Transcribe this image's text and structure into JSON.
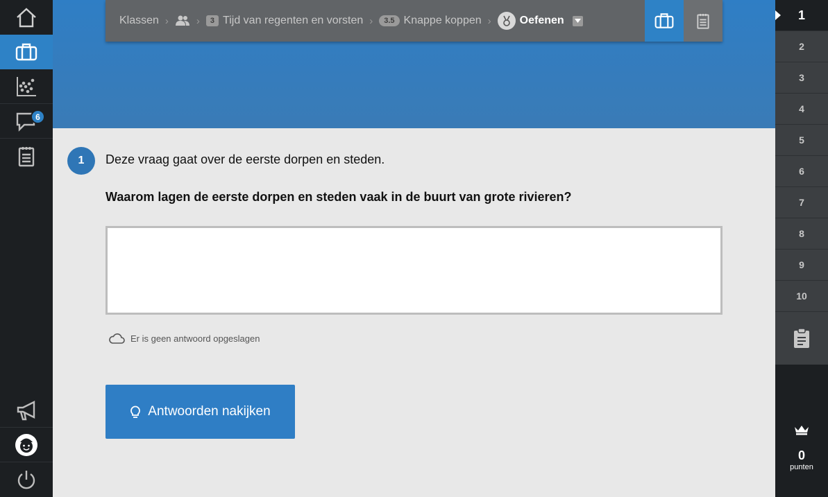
{
  "left_nav": {
    "messages_badge": "6"
  },
  "breadcrumb": {
    "klassen": "Klassen",
    "chapter_num": "3",
    "chapter": "Tijd van regenten en vorsten",
    "section_num": "3.5",
    "section": "Knappe koppen",
    "mode": "Oefenen"
  },
  "question": {
    "number": "1",
    "intro": "Deze vraag gaat over de eerste dorpen en steden.",
    "text": "Waarom lagen de eerste dorpen en steden vaak in de buurt van grote rivieren?",
    "answer_value": "",
    "save_status": "Er is geen antwoord opgeslagen",
    "check_button": "Antwoorden nakijken"
  },
  "question_list": {
    "items": [
      "1",
      "2",
      "3",
      "4",
      "5",
      "6",
      "7",
      "8",
      "9",
      "10"
    ],
    "current": "1"
  },
  "score": {
    "value": "0",
    "label": "punten"
  },
  "colors": {
    "accent": "#2e82c6",
    "sidebar": "#1c1f22",
    "topbar": "#616467"
  }
}
